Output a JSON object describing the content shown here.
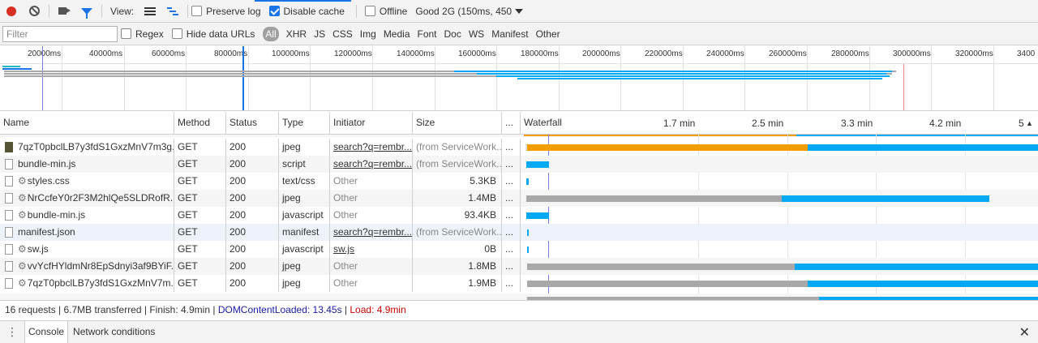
{
  "toolbar": {
    "view_label": "View:",
    "preserve_log": "Preserve log",
    "disable_cache": "Disable cache",
    "offline": "Offline",
    "throttle": "Good 2G (150ms, 450"
  },
  "filter_bar": {
    "placeholder": "Filter",
    "regex": "Regex",
    "hide_data_urls": "Hide data URLs",
    "types": [
      "All",
      "XHR",
      "JS",
      "CSS",
      "Img",
      "Media",
      "Font",
      "Doc",
      "WS",
      "Manifest",
      "Other"
    ]
  },
  "overview": {
    "ticks": [
      "20000ms",
      "40000ms",
      "60000ms",
      "80000ms",
      "100000ms",
      "120000ms",
      "140000ms",
      "160000ms",
      "180000ms",
      "200000ms",
      "220000ms",
      "240000ms",
      "260000ms",
      "280000ms",
      "300000ms",
      "320000ms",
      "3400"
    ]
  },
  "table": {
    "headers": {
      "name": "Name",
      "method": "Method",
      "status": "Status",
      "type": "Type",
      "initiator": "Initiator",
      "size": "Size",
      "more": "...",
      "waterfall": "Waterfall"
    },
    "waterfall_ticks": [
      "1.7 min",
      "2.5 min",
      "3.3 min",
      "4.2 min",
      "5"
    ],
    "rows": [
      {
        "name": "7qzT0pbclLB7y3fdS1GxzMnV7m3g...",
        "method": "GET",
        "status": "200",
        "type": "jpeg",
        "initiator": "search?q=rembr...",
        "size": "(from ServiceWork...",
        "more": "...",
        "icon": "image"
      },
      {
        "name": "bundle-min.js",
        "method": "GET",
        "status": "200",
        "type": "script",
        "initiator": "search?q=rembr...",
        "size": "(from ServiceWork...",
        "more": "...",
        "icon": "file"
      },
      {
        "name": "styles.css",
        "method": "GET",
        "status": "200",
        "type": "text/css",
        "initiator": "Other",
        "size": "5.3KB",
        "more": "...",
        "icon": "gear"
      },
      {
        "name": "NrCcfeY0r2F3M2hlQe5SLDRofR...",
        "method": "GET",
        "status": "200",
        "type": "jpeg",
        "initiator": "Other",
        "size": "1.4MB",
        "more": "...",
        "icon": "gear"
      },
      {
        "name": "bundle-min.js",
        "method": "GET",
        "status": "200",
        "type": "javascript",
        "initiator": "Other",
        "size": "93.4KB",
        "more": "...",
        "icon": "gear"
      },
      {
        "name": "manifest.json",
        "method": "GET",
        "status": "200",
        "type": "manifest",
        "initiator": "search?q=rembr...",
        "size": "(from ServiceWork...",
        "more": "...",
        "icon": "file"
      },
      {
        "name": "sw.js",
        "method": "GET",
        "status": "200",
        "type": "javascript",
        "initiator": "sw.js",
        "size": "0B",
        "more": "...",
        "icon": "gear"
      },
      {
        "name": "vvYcfHYldmNr8EpSdnyi3af9BYiF...",
        "method": "GET",
        "status": "200",
        "type": "jpeg",
        "initiator": "Other",
        "size": "1.8MB",
        "more": "...",
        "icon": "gear"
      },
      {
        "name": "7qzT0pbclLB7y3fdS1GxzMnV7m...",
        "method": "GET",
        "status": "200",
        "type": "jpeg",
        "initiator": "Other",
        "size": "1.9MB",
        "more": "...",
        "icon": "gear"
      }
    ]
  },
  "status_bar": {
    "summary": "16 requests | 6.7MB transferred | Finish: 4.9min | ",
    "dom_content_loaded": "DOMContentLoaded: 13.45s",
    "divider": " | ",
    "load": "Load: 4.9min"
  },
  "drawer": {
    "tabs": [
      "Console",
      "Network conditions"
    ]
  },
  "colors": {
    "accent": "#1a73e8",
    "waiting": "#f29e02",
    "download": "#03a9f4",
    "queued": "#a8a8a8"
  }
}
